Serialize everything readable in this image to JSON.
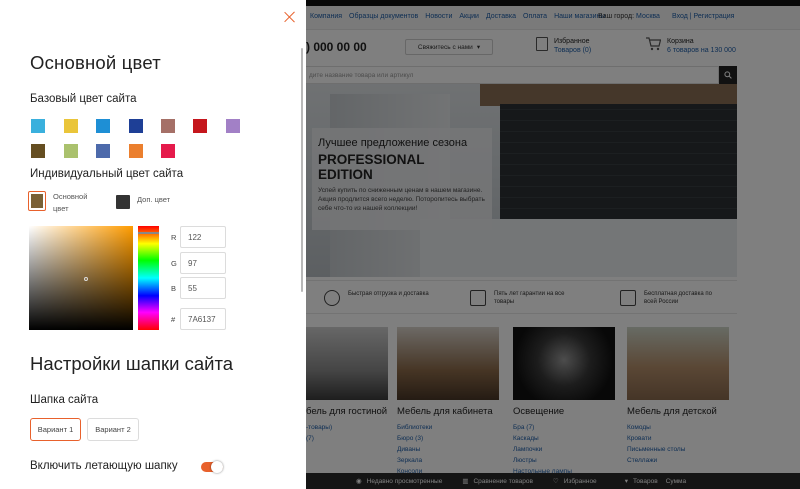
{
  "site": {
    "top_nav": [
      "Компания",
      "Образцы документов",
      "Новости",
      "Акции",
      "Доставка",
      "Оплата",
      "Наши магазины"
    ],
    "city_label": "Ваш город:",
    "city_value": "Москва",
    "login": "Вход | Регистрация",
    "phone": ") 000 00 00",
    "contact_button": "Свяжитесь с нами",
    "favorites_title": "Избранное",
    "favorites_sub": "Товаров (0)",
    "cart_title": "Корзина",
    "cart_sub": "6 товаров на 130 000",
    "search_placeholder": "дите название товара или артикул",
    "promo_line1": "Лучшее предложение сезона",
    "promo_line2": "PROFESSIONAL",
    "promo_line3": "EDITION",
    "promo_text": "Успей купить по сниженным ценам в нашем магазине. Акция продлится всего неделю. Поторопитесь выбрать себе что-то из нашей коллекции!",
    "features": [
      {
        "icon": "speedometer-icon",
        "text": "Быстрая отгрузка и доставка"
      },
      {
        "icon": "warranty-icon",
        "text": "Пять лет гарантии на все товары"
      },
      {
        "icon": "delivery-cart-icon",
        "text": "Бесплатная доставка по всей России"
      }
    ],
    "categories": [
      {
        "name": "бель для гостиной",
        "subs": [
          "-товары)",
          "",
          "(7)"
        ]
      },
      {
        "name": "Мебель для кабинета",
        "subs": [
          "Библиотеки",
          "Бюро (3)",
          "Диваны",
          "Зеркала",
          "Консоли"
        ]
      },
      {
        "name": "Освещение",
        "subs": [
          "Бра (7)",
          "Каскады",
          "Лампочки",
          "Люстры",
          "Настольные лампы"
        ]
      },
      {
        "name": "Мебель для детской",
        "subs": [
          "Комоды",
          "Кровати",
          "Письменные столы",
          "Стеллажи"
        ]
      }
    ],
    "bottom_bar": {
      "recent": "Недавно просмотренные",
      "compare": "Сравнение товаров",
      "fav": "Избранное",
      "goods": "Товаров",
      "sum": "Сумма"
    }
  },
  "panel": {
    "title_main_color": "Основной цвет",
    "base_color_label": "Базовый цвет сайта",
    "base_colors": [
      "#3ab0dd",
      "#eac53a",
      "#1e8fd5",
      "#1e3f96",
      "#a57067",
      "#c5161d",
      "#a280c6",
      "#654e21",
      "#aac16d",
      "#4d6aab",
      "#eb7f2e",
      "#e51a4b"
    ],
    "custom_color_label": "Индивидуальный цвет сайта",
    "main_color_label": "Основной цвет",
    "main_color_value": "#7A6137",
    "alt_color_label": "Доп. цвет",
    "alt_color_value": "#333333",
    "rgb": {
      "r_label": "R",
      "g_label": "G",
      "b_label": "B",
      "hex_label": "#",
      "r": "122",
      "g": "97",
      "b": "55",
      "hex": "7A6137"
    },
    "header_settings_title": "Настройки шапки сайта",
    "header_label": "Шапка сайта",
    "variant1": "Вариант 1",
    "variant2": "Вариант 2",
    "sticky_header_label": "Включить летающую шапку",
    "sticky_header_on": true,
    "accent_color": "#e8612c"
  }
}
